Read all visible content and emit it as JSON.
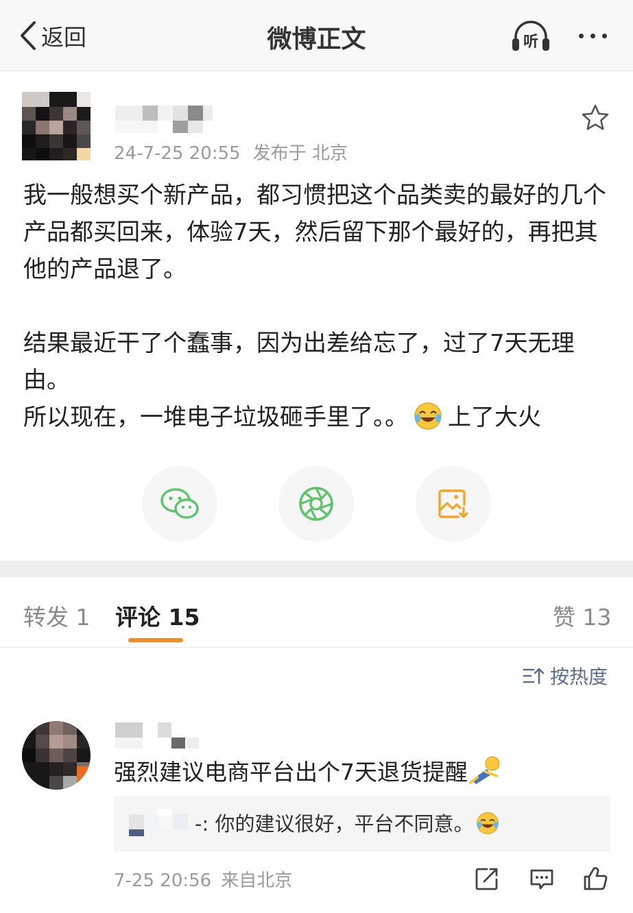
{
  "nav": {
    "back_label": "返回",
    "title": "微博正文",
    "listen_icon_text": "听"
  },
  "post": {
    "time": "24-7-25 20:55",
    "location": "发布于 北京",
    "paragraphs": [
      "我一般想买个新产品，都习惯把这个品类卖的最好的几个产品都买回来，体验7天，然后留下那个最好的，再把其他的产品退了。",
      "结果最近干了个蠢事，因为出差给忘了，过了7天无理由。"
    ],
    "last_line_text": "所以现在，一堆电子垃圾砸手里了。。",
    "last_line_tail": "上了大火"
  },
  "share": [
    "wechat-icon",
    "moments-icon",
    "save-image-icon"
  ],
  "tabs": {
    "repost": "转发 1",
    "comments": "评论 15",
    "likes": "赞 13"
  },
  "sort_label": "按热度",
  "comment": {
    "text": "强烈建议电商平台出个7天退货提醒",
    "reply_name_tail": "-:",
    "reply_text": "你的建议很好，平台不同意。",
    "time": "7-25 20:56",
    "source": "来自北京"
  },
  "colors": {
    "accent_orange": "#f28b22",
    "wechat_green": "#5cc46b",
    "save_orange": "#f4a623",
    "link_blue": "#5a6e92"
  }
}
